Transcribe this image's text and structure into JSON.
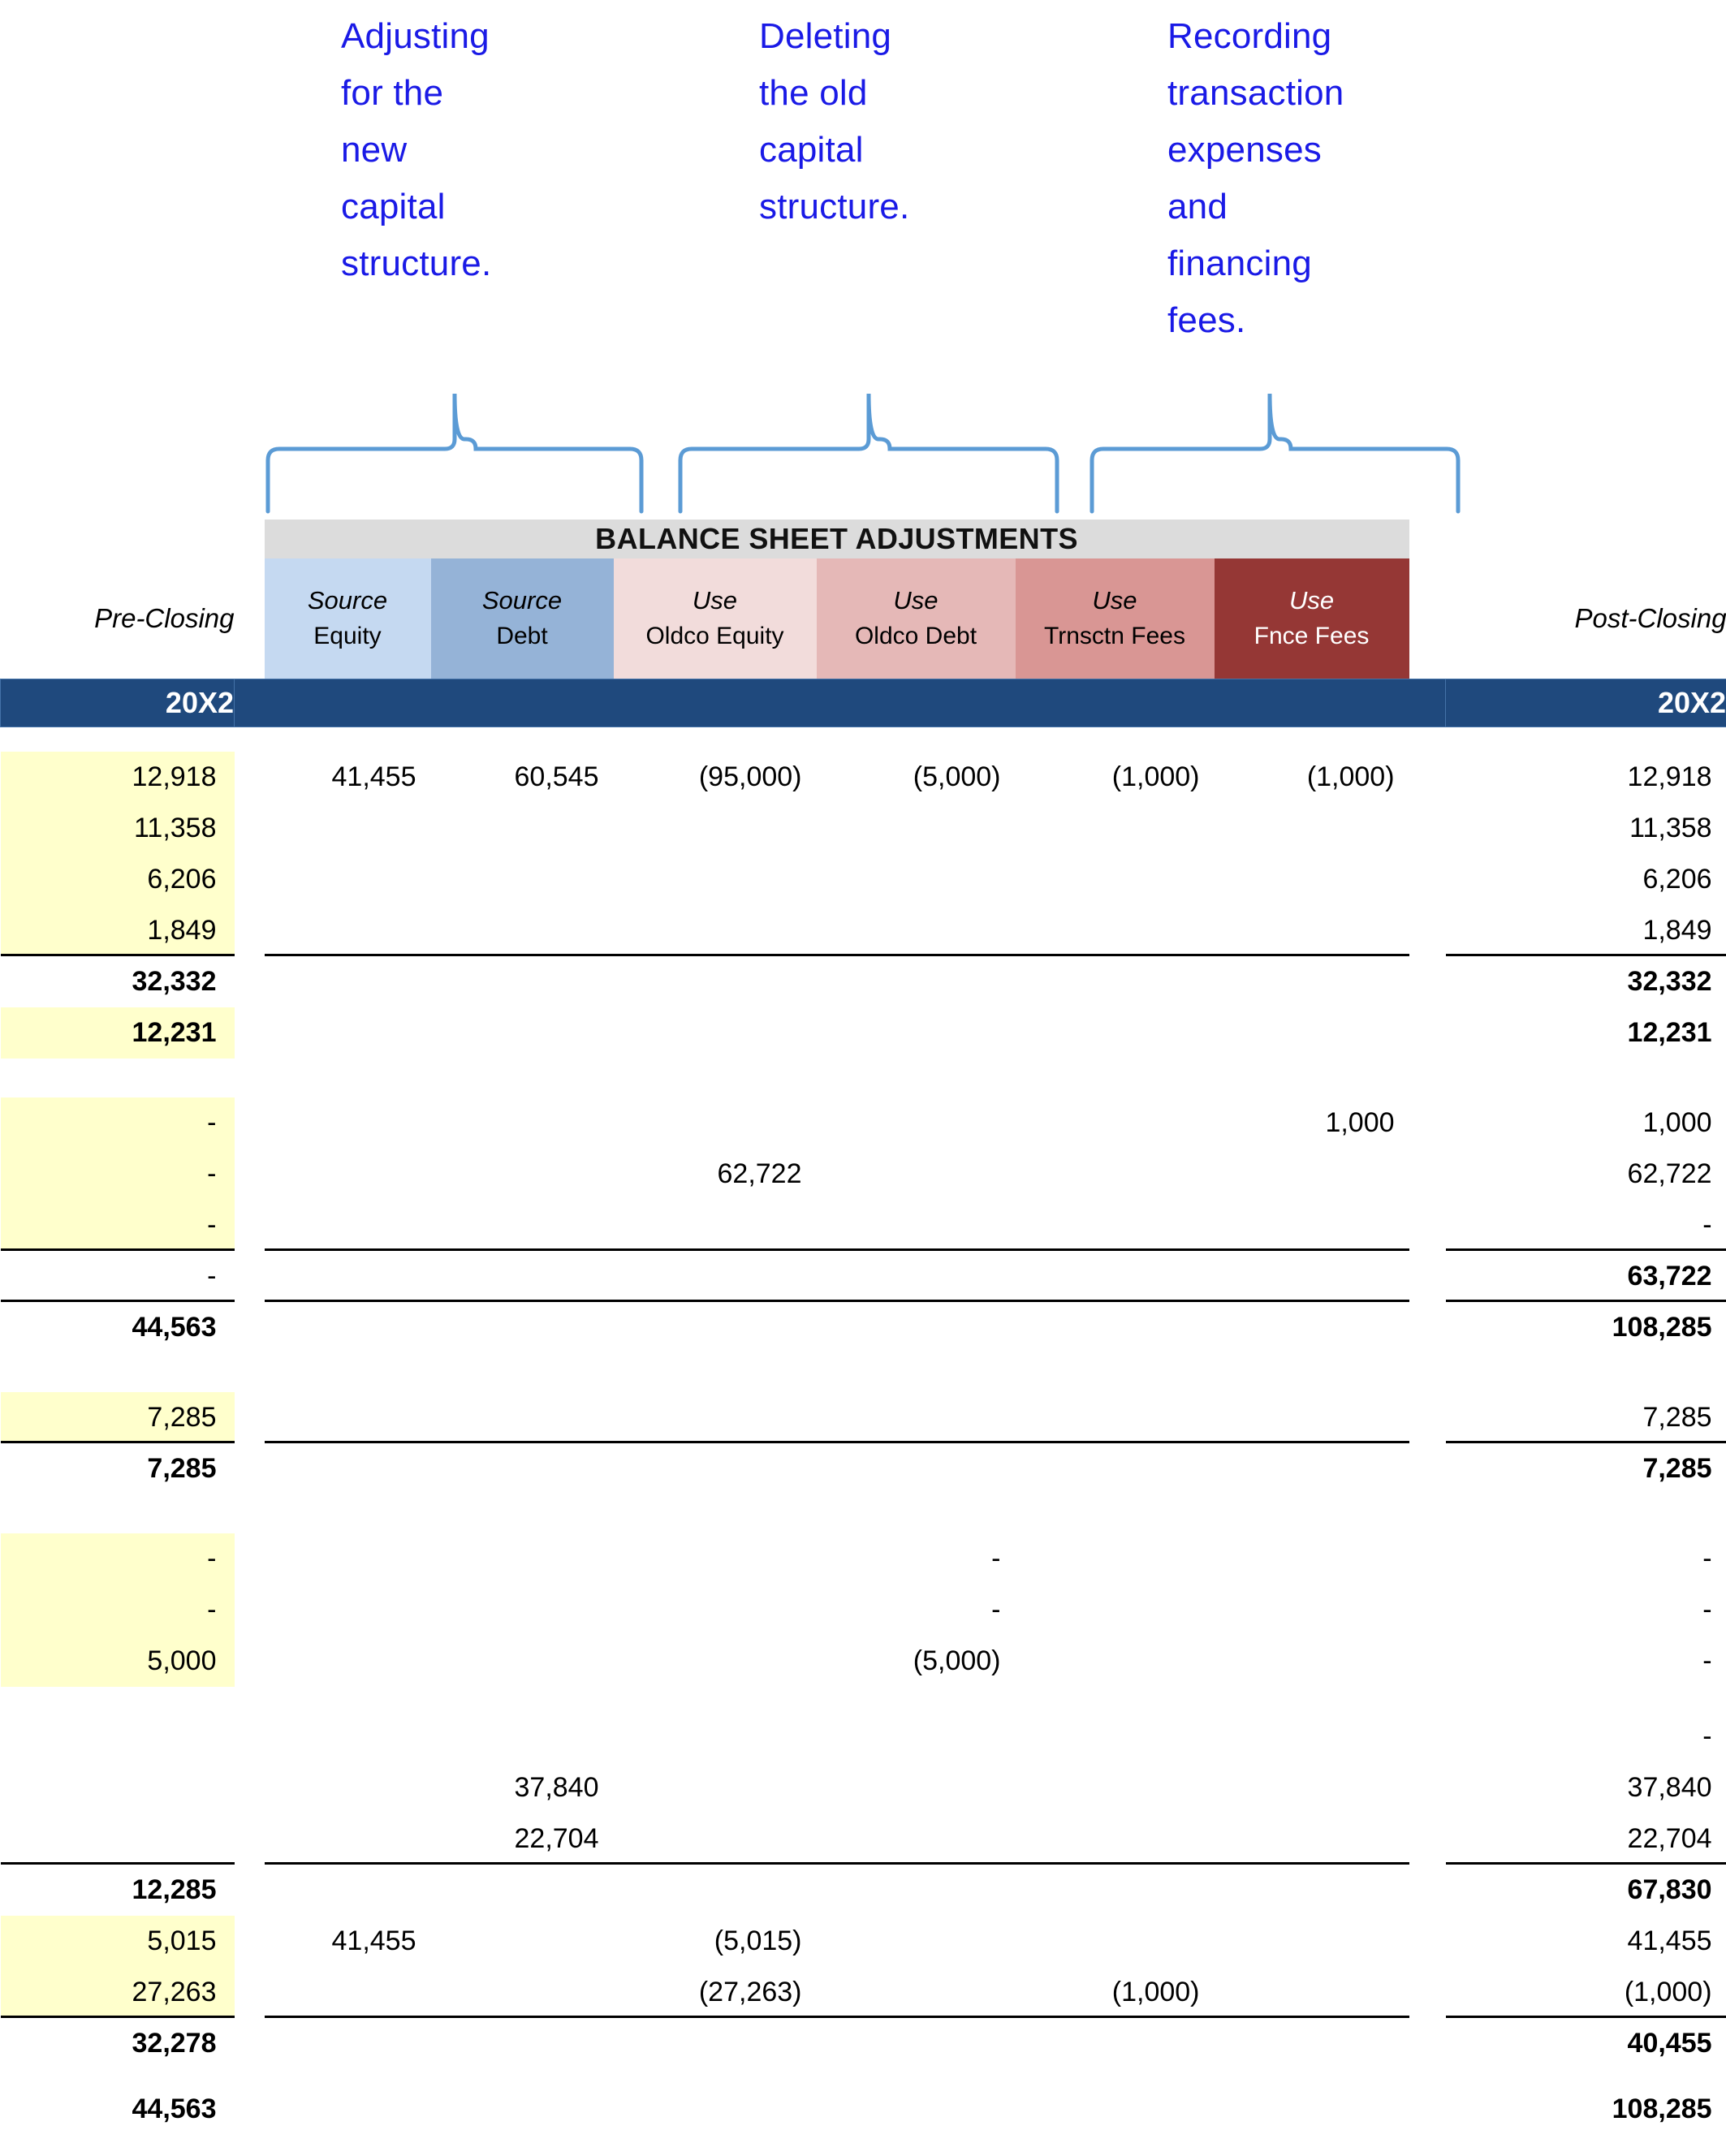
{
  "callouts": [
    {
      "text": "Adjusting\nfor the\nnew\ncapital\nstructure.",
      "color": "#1a1ae6"
    },
    {
      "text": "Deleting\nthe old\ncapital\nstructure.",
      "color": "#1a1ae6"
    },
    {
      "text": "Recording\ntransaction\nexpenses\nand\nfinancing\nfees.",
      "color": "#1a1ae6"
    }
  ],
  "header": {
    "band_title": "BALANCE SHEET ADJUSTMENTS",
    "pre_closing": "Pre-Closing",
    "post_closing": "Post-Closing",
    "year_left": "20X2",
    "year_right": "20X2",
    "columns": [
      {
        "line1": "Source",
        "line2": "Equity",
        "bg": "#c5d9f1"
      },
      {
        "line1": "Source",
        "line2": "Debt",
        "bg": "#95b3d7"
      },
      {
        "line1": "Use",
        "line2": "Oldco Equity",
        "bg": "#f2dcdb"
      },
      {
        "line1": "Use",
        "line2": "Oldco Debt",
        "bg": "#e5b8b7"
      },
      {
        "line1": "Use",
        "line2": "Trnsctn Fees",
        "bg": "#d99694"
      },
      {
        "line1": "Use",
        "line2": "Fnce Fees",
        "bg": "#953735"
      }
    ]
  },
  "colors": {
    "input_blue": "#1111cc",
    "year_band": "#1f497d",
    "bsa_band": "#dcdcdc",
    "highlight_yellow": "#ffffcc",
    "brace_blue": "#5b9bd5",
    "callout_blue": "#1a1ae6"
  },
  "rows": [
    {
      "kind": "data",
      "pre": "12,918",
      "pre_style": "yel-blue",
      "se": "41,455",
      "sd": "60,545",
      "oe": "(95,000)",
      "od": "(5,000)",
      "tf": "(1,000)",
      "ff": "(1,000)",
      "post": "12,918"
    },
    {
      "kind": "data",
      "pre": "11,358",
      "pre_style": "yel-blue",
      "se": "",
      "sd": "",
      "oe": "",
      "od": "",
      "tf": "",
      "ff": "",
      "post": "11,358"
    },
    {
      "kind": "data",
      "pre": "6,206",
      "pre_style": "yel-blue",
      "se": "",
      "sd": "",
      "oe": "",
      "od": "",
      "tf": "",
      "ff": "",
      "post": "6,206"
    },
    {
      "kind": "data",
      "pre": "1,849",
      "pre_style": "yel-blue-ul",
      "se": "",
      "sd": "",
      "oe": "",
      "od": "",
      "tf": "",
      "ff": "",
      "post": "1,849",
      "post_style": "ul",
      "mid_rule": true
    },
    {
      "kind": "total",
      "pre": "32,332",
      "se": "",
      "sd": "",
      "oe": "",
      "od": "",
      "tf": "",
      "ff": "",
      "post": "32,332"
    },
    {
      "kind": "data",
      "pre": "12,231",
      "pre_style": "yel-blue-bold",
      "se": "",
      "sd": "",
      "oe": "",
      "od": "",
      "tf": "",
      "ff": "",
      "post": "12,231",
      "post_style": "bold"
    },
    {
      "kind": "spacer"
    },
    {
      "kind": "data",
      "pre": "-",
      "pre_style": "yel-blue",
      "se": "",
      "sd": "",
      "oe": "",
      "od": "",
      "tf": "",
      "ff": "1,000",
      "post": "1,000"
    },
    {
      "kind": "data",
      "pre": "-",
      "pre_style": "yel-blue",
      "se": "",
      "sd": "",
      "oe": "62,722",
      "od": "",
      "tf": "",
      "ff": "",
      "post": "62,722"
    },
    {
      "kind": "data",
      "pre": "-",
      "pre_style": "yel-blue-ul",
      "se": "",
      "sd": "",
      "oe": "",
      "od": "",
      "tf": "",
      "ff": "",
      "post": "-",
      "post_style": "ul",
      "mid_rule": true
    },
    {
      "kind": "data",
      "pre": "-",
      "pre_style": "ul",
      "se": "",
      "sd": "",
      "oe": "",
      "od": "",
      "tf": "",
      "ff": "",
      "post": "63,722",
      "post_style": "bold-ul",
      "mid_rule": true
    },
    {
      "kind": "total",
      "pre": "44,563",
      "se": "",
      "sd": "",
      "oe": "",
      "od": "",
      "tf": "",
      "ff": "",
      "post": "108,285"
    },
    {
      "kind": "spacer"
    },
    {
      "kind": "data",
      "pre": "7,285",
      "pre_style": "yel-blue-ul",
      "se": "",
      "sd": "",
      "oe": "",
      "od": "",
      "tf": "",
      "ff": "",
      "post": "7,285",
      "post_style": "ul",
      "mid_rule": true
    },
    {
      "kind": "total",
      "pre": "7,285",
      "se": "",
      "sd": "",
      "oe": "",
      "od": "",
      "tf": "",
      "ff": "",
      "post": "7,285"
    },
    {
      "kind": "spacer"
    },
    {
      "kind": "data",
      "pre": "-",
      "pre_style": "yel-blue",
      "se": "",
      "sd": "",
      "oe": "",
      "od": "-",
      "tf": "",
      "ff": "",
      "post": "-"
    },
    {
      "kind": "data",
      "pre": "-",
      "pre_style": "yel-blue",
      "se": "",
      "sd": "",
      "oe": "",
      "od": "-",
      "tf": "",
      "ff": "",
      "post": "-"
    },
    {
      "kind": "data",
      "pre": "5,000",
      "pre_style": "yel-blue",
      "se": "",
      "sd": "",
      "oe": "",
      "od": "(5,000)",
      "tf": "",
      "ff": "",
      "post": "-"
    },
    {
      "kind": "spacer-s"
    },
    {
      "kind": "data",
      "pre": "",
      "se": "",
      "sd": "",
      "oe": "",
      "od": "",
      "tf": "",
      "ff": "",
      "post": "-"
    },
    {
      "kind": "data",
      "pre": "",
      "se": "",
      "sd": "37,840",
      "oe": "",
      "od": "",
      "tf": "",
      "ff": "",
      "post": "37,840"
    },
    {
      "kind": "data",
      "pre": "",
      "se": "",
      "sd": "22,704",
      "oe": "",
      "od": "",
      "tf": "",
      "ff": "",
      "post": "22,704",
      "pre_style": "ul",
      "post_style": "ul",
      "mid_rule": true
    },
    {
      "kind": "total",
      "pre": "12,285",
      "se": "",
      "sd": "",
      "oe": "",
      "od": "",
      "tf": "",
      "ff": "",
      "post": "67,830"
    },
    {
      "kind": "data",
      "pre": "5,015",
      "pre_style": "yel-blue",
      "se": "41,455",
      "sd": "",
      "oe": "(5,015)",
      "od": "",
      "tf": "",
      "ff": "",
      "post": "41,455"
    },
    {
      "kind": "data",
      "pre": "27,263",
      "pre_style": "yel-blue-ul",
      "se": "",
      "sd": "",
      "oe": "(27,263)",
      "od": "",
      "tf": "(1,000)",
      "ff": "",
      "post": "(1,000)",
      "post_style": "ul",
      "mid_rule": true
    },
    {
      "kind": "total",
      "pre": "32,278",
      "se": "",
      "sd": "",
      "oe": "",
      "od": "",
      "tf": "",
      "ff": "",
      "post": "40,455"
    },
    {
      "kind": "spacer-xs"
    },
    {
      "kind": "total",
      "pre": "44,563",
      "se": "",
      "sd": "",
      "oe": "",
      "od": "",
      "tf": "",
      "ff": "",
      "post": "108,285"
    }
  ]
}
